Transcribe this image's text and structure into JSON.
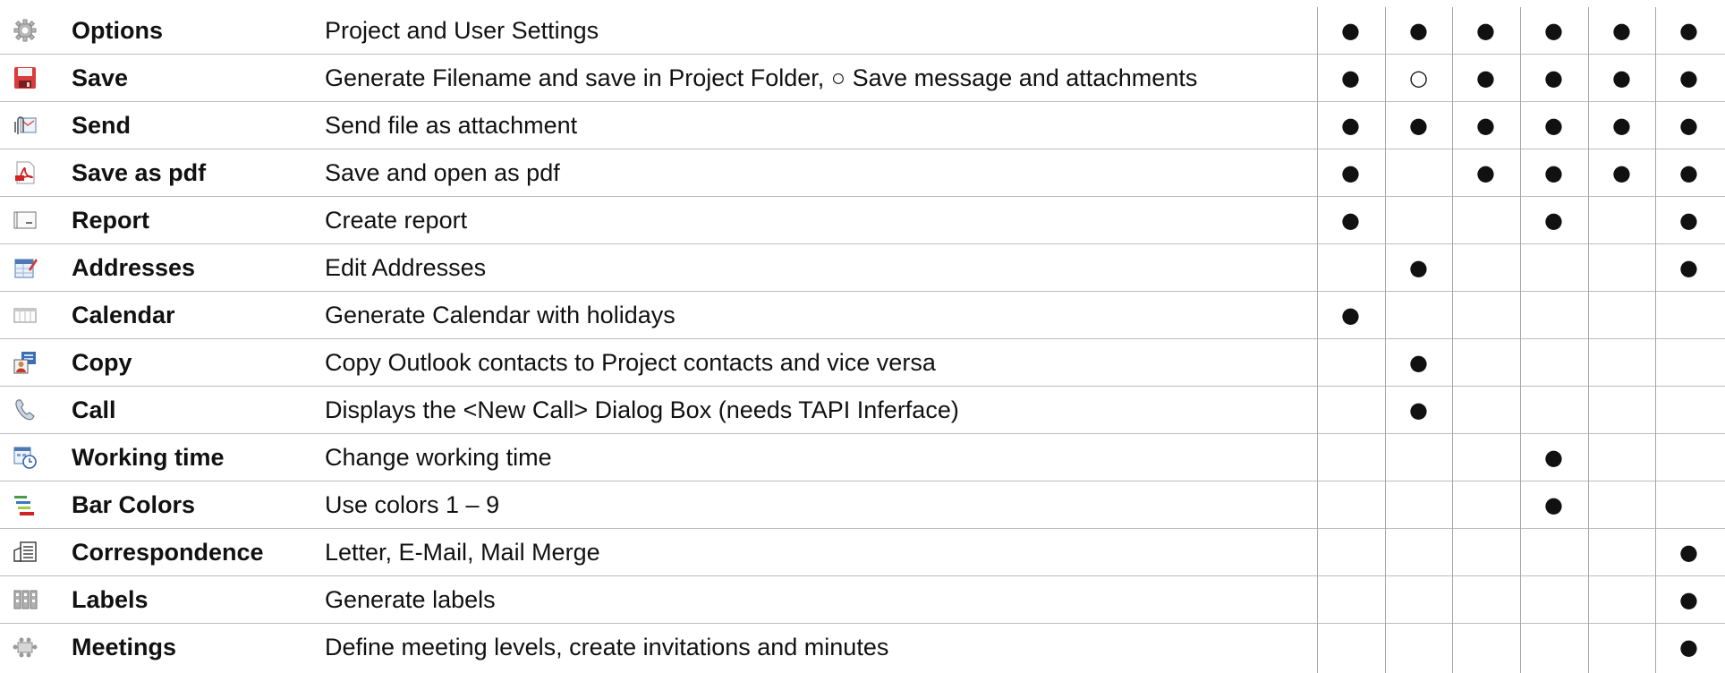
{
  "rows": [
    {
      "icon": "gear-icon",
      "name": "Options",
      "desc": "Project and User Settings",
      "marks": [
        "●",
        "●",
        "●",
        "●",
        "●",
        "●"
      ]
    },
    {
      "icon": "floppy-disk-icon",
      "name": "Save",
      "desc": "Generate Filename and save in Project Folder, ○ Save message and attachments",
      "marks": [
        "●",
        "○",
        "●",
        "●",
        "●",
        "●"
      ]
    },
    {
      "icon": "send-attachment-icon",
      "name": "Send",
      "desc": "Send file as attachment",
      "marks": [
        "●",
        "●",
        "●",
        "●",
        "●",
        "●"
      ]
    },
    {
      "icon": "pdf-icon",
      "name": "Save as pdf",
      "desc": "Save and open as pdf",
      "marks": [
        "●",
        "",
        "●",
        "●",
        "●",
        "●"
      ]
    },
    {
      "icon": "report-icon",
      "name": "Report",
      "desc": "Create report",
      "marks": [
        "●",
        "",
        "",
        "●",
        "",
        "●"
      ]
    },
    {
      "icon": "address-book-icon",
      "name": "Addresses",
      "desc": "Edit Addresses",
      "marks": [
        "",
        "●",
        "",
        "",
        "",
        "●"
      ]
    },
    {
      "icon": "calendar-icon",
      "name": "Calendar",
      "desc": "Generate Calendar with holidays",
      "marks": [
        "●",
        "",
        "",
        "",
        "",
        ""
      ]
    },
    {
      "icon": "contacts-copy-icon",
      "name": "Copy",
      "desc": "Copy Outlook contacts to Project contacts and vice versa",
      "marks": [
        "",
        "●",
        "",
        "",
        "",
        ""
      ]
    },
    {
      "icon": "phone-icon",
      "name": "Call",
      "desc": "Displays the <New Call> Dialog Box (needs TAPI Inferface)",
      "marks": [
        "",
        "●",
        "",
        "",
        "",
        ""
      ]
    },
    {
      "icon": "working-time-icon",
      "name": "Working time",
      "desc": "Change working time",
      "marks": [
        "",
        "",
        "",
        "●",
        "",
        ""
      ]
    },
    {
      "icon": "bar-colors-icon",
      "name": "Bar Colors",
      "desc": "Use colors 1 – 9",
      "marks": [
        "",
        "",
        "",
        "●",
        "",
        ""
      ]
    },
    {
      "icon": "correspondence-icon",
      "name": "Correspondence",
      "desc": "Letter, E-Mail, Mail Merge",
      "marks": [
        "",
        "",
        "",
        "",
        "",
        "●"
      ]
    },
    {
      "icon": "labels-icon",
      "name": "Labels",
      "desc": "Generate labels",
      "marks": [
        "",
        "",
        "",
        "",
        "",
        "●"
      ]
    },
    {
      "icon": "meetings-icon",
      "name": "Meetings",
      "desc": "Define meeting levels, create invitations and minutes",
      "marks": [
        "",
        "",
        "",
        "",
        "",
        "●"
      ]
    }
  ]
}
